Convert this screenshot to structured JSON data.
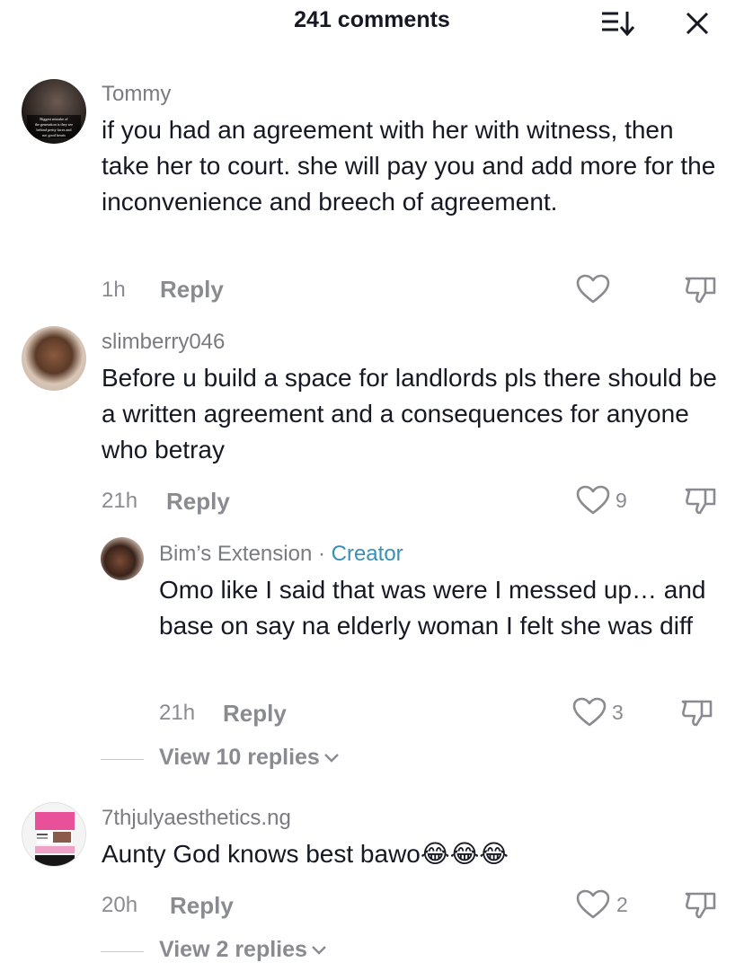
{
  "header": {
    "title": "241 comments"
  },
  "comments": [
    {
      "username": "Tommy",
      "text": "if you had an agreement with her with witness, then take her to court. she will pay you and add more for the inconvenience and breech of agreement.",
      "time": "1h",
      "reply_label": "Reply",
      "likes": ""
    },
    {
      "username": "slimberry046",
      "text": "Before u build a space for landlords pls there should be a written agreement and a consequences for anyone who betray",
      "time": "21h",
      "reply_label": "Reply",
      "likes": "9"
    },
    {
      "username": "Bim’s Extension",
      "creator_sep": " · ",
      "creator_label": "Creator",
      "text": "Omo like I said that was were I messed up… and base on say na elderly woman I felt she was diff",
      "time": "21h",
      "reply_label": "Reply",
      "likes": "3",
      "view_replies": "View 10 replies"
    },
    {
      "username": "7thjulyaesthetics.ng",
      "text": "Aunty God knows best bawo😂😂😂",
      "time": "20h",
      "reply_label": "Reply",
      "likes": "2",
      "view_replies": "View 2 replies"
    }
  ],
  "avatar_texts": {
    "tommy": "Biggest mistake of the generation is they see behind pretty faces and not good hearts"
  },
  "colors": {
    "creator_accent": "#3a8fb6",
    "muted": "#8a8b91",
    "text": "#161823"
  },
  "icons": {
    "sort": "sort-icon",
    "close": "close-icon",
    "like": "heart-outline-icon",
    "dislike": "thumbs-down-icon",
    "expand": "chevron-down-icon"
  }
}
